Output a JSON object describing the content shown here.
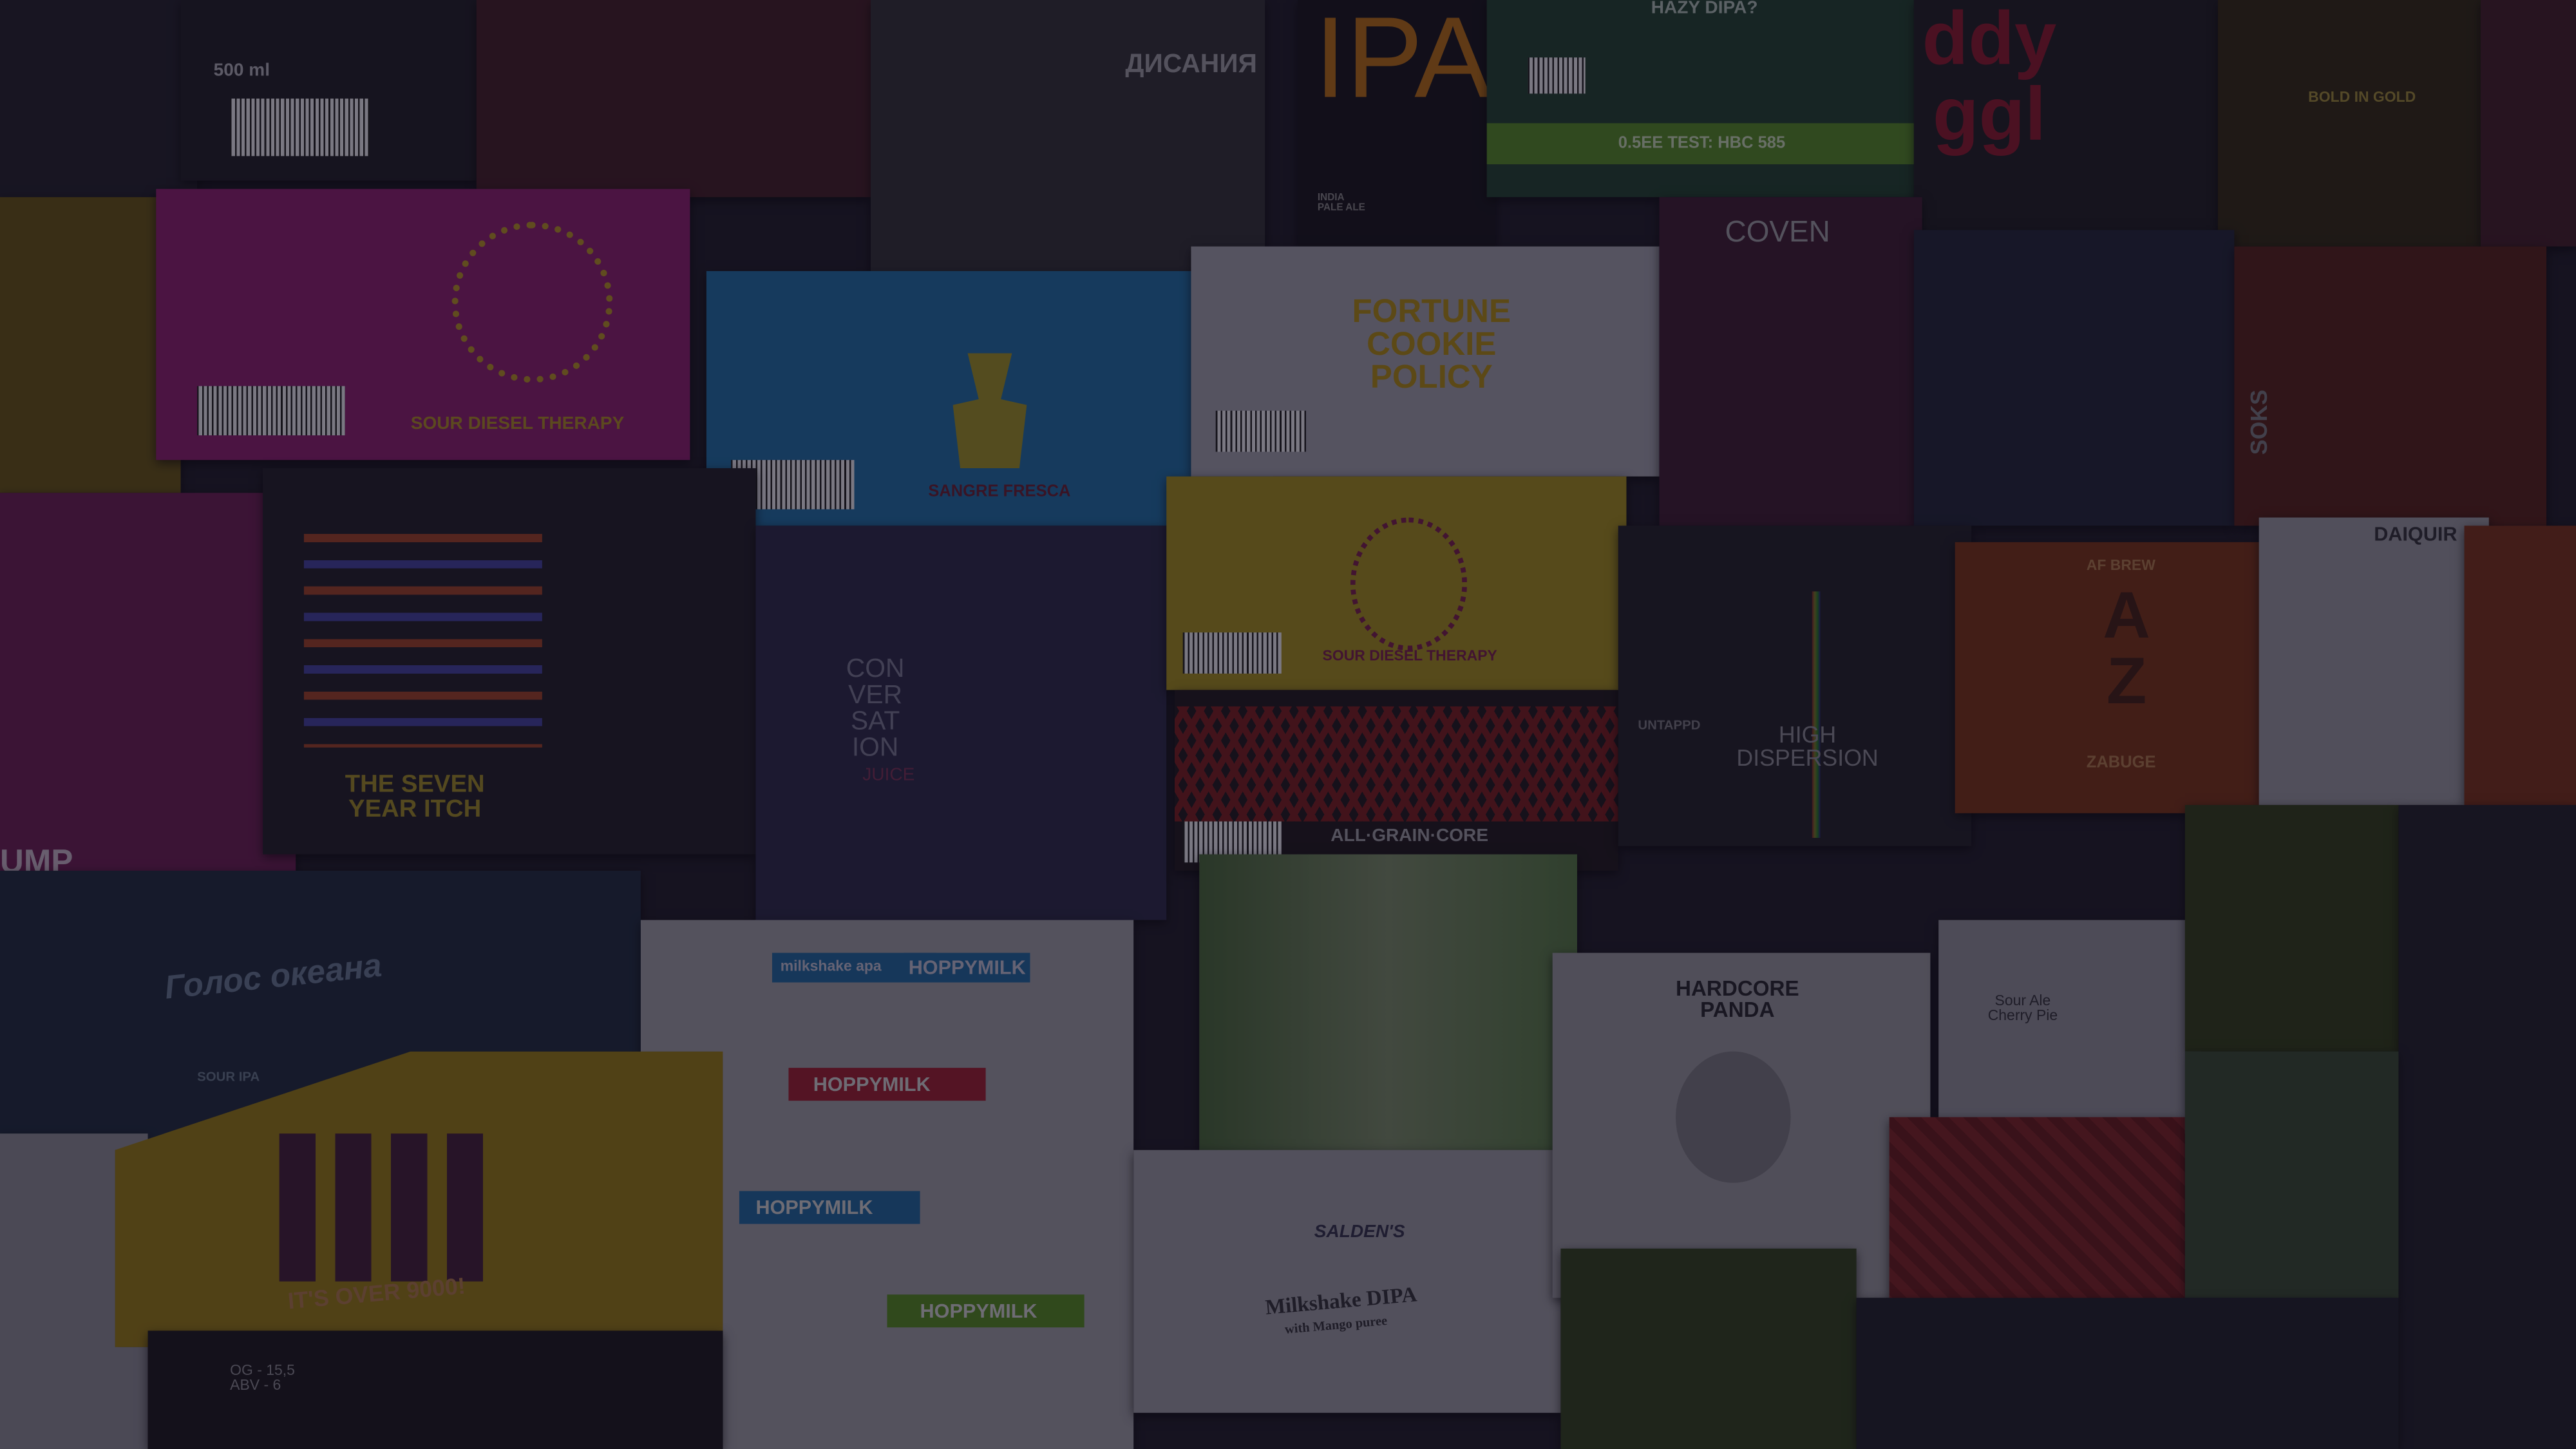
{
  "scene": "beer-label-collage",
  "labels": {
    "sour_diesel_magenta": "SOUR DIESEL THERAPY",
    "sangre_fresca": "SANGRE FRESCA",
    "fortune_cookie": "FORTUNE\nCOOKIE\nPOLICY",
    "sour_diesel_yellow": "SOUR DIESEL THERAPY",
    "all_grain_core": "ALL·GRAIN·CORE",
    "conversation": "CON\nVER\nSAT\nION",
    "conversation_sub": "JUICE",
    "seven_year_itch": "THE SEVEN\nYEAR ITCH",
    "ipa": "IPA",
    "ipa_sub": "INDIA\nPALE ALE",
    "hazy_dipa": "HAZY DIPA?",
    "hazy_bar": "0.5EE TEST: HBC 585",
    "coven": "COVEN",
    "daddy": "ddy\nggl",
    "big_gold": "BOLD IN GOLD",
    "soks": "SOKS",
    "az_brew": "AF BREW",
    "az": "A\nZ",
    "az_sub": "ZABUGE",
    "daiquiri": "DAIQUIR",
    "high_dispersion": "HIGH\nDISPERSION",
    "untappd": "UNTAPPD",
    "hardcore_panda": "HARDCORE\nPANDA",
    "sour_ale": "Sour Ale\nCherry Pie",
    "hoppymilk": "HOPPYMILK",
    "milkshake_apa": "milkshake apa",
    "milkshake_dipa": "Milkshake DIPA",
    "milkshake_dipa_sub": "with Mango puree",
    "saldens": "SALDEN'S",
    "ocean": "Голос океана",
    "ocean_sub": "SOUR IPA",
    "over_9000": "IT'S OVER 9000!",
    "volume": "500 ml",
    "dysania": "ДИСАНИЯ",
    "pump": "UMP\nY",
    "og": "OG - 15,5\nABV - 6"
  }
}
